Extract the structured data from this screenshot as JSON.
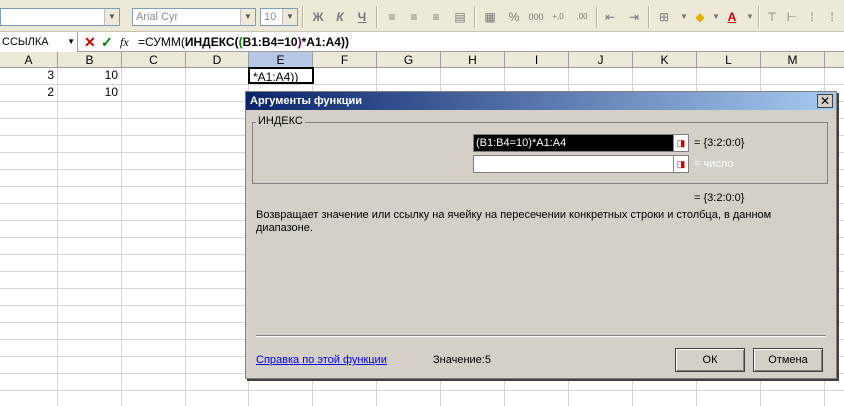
{
  "toolbar": {
    "font_name": "Arial Cyr",
    "font_size": "10",
    "bold": "Ж",
    "italic": "К",
    "underline": "Ч",
    "percent": "%",
    "thousands": "000",
    "inc_decimal": "+,0",
    "dec_decimal": ",00"
  },
  "formula_bar": {
    "name_box": "ССЫЛКА",
    "cancel": "✕",
    "enter": "✓",
    "fx": "fx",
    "formula_prefix": "=СУММ(",
    "formula_func": "ИНДЕКС",
    "formula_open": "(",
    "formula_paren_hl": "(",
    "formula_cond": "B1:B4=10",
    "formula_close_hl": ")",
    "formula_mult": "*A1:A4",
    "formula_end": "))"
  },
  "grid": {
    "columns": [
      "A",
      "B",
      "C",
      "D",
      "E",
      "F",
      "G",
      "H",
      "I",
      "J",
      "K",
      "L",
      "M"
    ],
    "selected_column": "E",
    "cells": {
      "a1": "3",
      "b1": "10",
      "a2": "2",
      "b2": "10",
      "e1": "*A1:A4))"
    }
  },
  "dialog": {
    "title": "Аргументы функции",
    "close": "✕",
    "group_label": "ИНДЕКС",
    "arg1_value": "(B1:B4=10)*A1:A4",
    "arg1_result": "= {3:2:0:0}",
    "arg2_value": "",
    "arg2_result": "= число",
    "overall_result": "= {3:2:0:0}",
    "description": "Возвращает значение или ссылку на ячейку на пересечении конкретных строки и столбца, в данном диапазоне.",
    "help_link": "Справка по этой функции",
    "value_label": "Значение:",
    "value": "5",
    "ok": "ОК",
    "cancel": "Отмена"
  },
  "colors": {
    "title_gradient_start": "#0a246a",
    "title_gradient_end": "#a6caf0",
    "dialog_bg": "#d4d0c8",
    "toolbar_bg": "#ece9d8",
    "cancel_icon": "#cc0000",
    "enter_icon": "#008000",
    "link": "#0000ee"
  }
}
